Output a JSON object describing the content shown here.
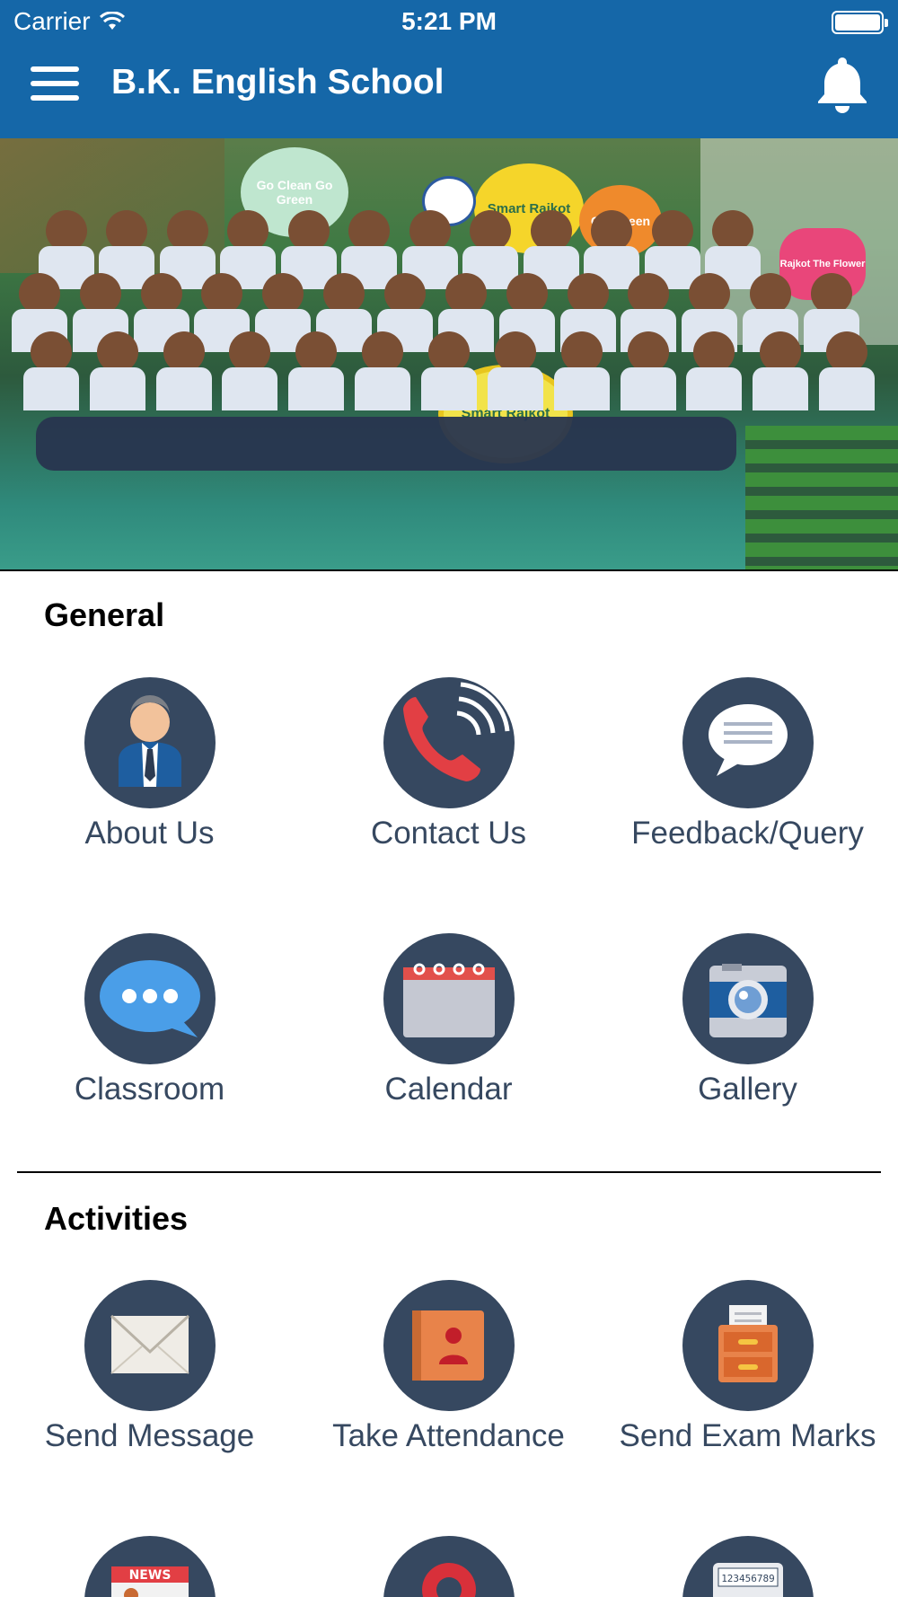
{
  "status_bar": {
    "carrier": "Carrier",
    "time": "5:21 PM"
  },
  "header": {
    "title": "B.K. English School"
  },
  "banner": {
    "slides": 4,
    "active_slide": 3,
    "flower_texts": [
      "Go Clean Go Green",
      "Smart Rajkot",
      "GO Green",
      "Smart Rajkot"
    ],
    "badge_text": "Rajkot The Flower"
  },
  "general": {
    "title": "General",
    "items": [
      {
        "label": "About Us",
        "icon": "person-icon"
      },
      {
        "label": "Contact Us",
        "icon": "phone-icon"
      },
      {
        "label": "Feedback/Query",
        "icon": "speech-bubble-icon"
      },
      {
        "label": "Classroom",
        "icon": "chat-dots-icon"
      },
      {
        "label": "Calendar",
        "icon": "calendar-icon"
      },
      {
        "label": "Gallery",
        "icon": "camera-icon"
      }
    ]
  },
  "activities": {
    "title": "Activities",
    "items": [
      {
        "label": "Send Message",
        "icon": "envelope-icon"
      },
      {
        "label": "Take Attendance",
        "icon": "contact-book-icon"
      },
      {
        "label": "Send Exam Marks",
        "icon": "file-cabinet-icon"
      },
      {
        "label": "",
        "icon": "news-icon",
        "icon_text": "NEWS"
      },
      {
        "label": "",
        "icon": "location-pin-icon"
      },
      {
        "label": "",
        "icon": "calculator-icon",
        "icon_text": "123456789"
      }
    ]
  },
  "colors": {
    "header": "#1567a8",
    "icon_circle": "#364860",
    "label_text": "#364860"
  }
}
